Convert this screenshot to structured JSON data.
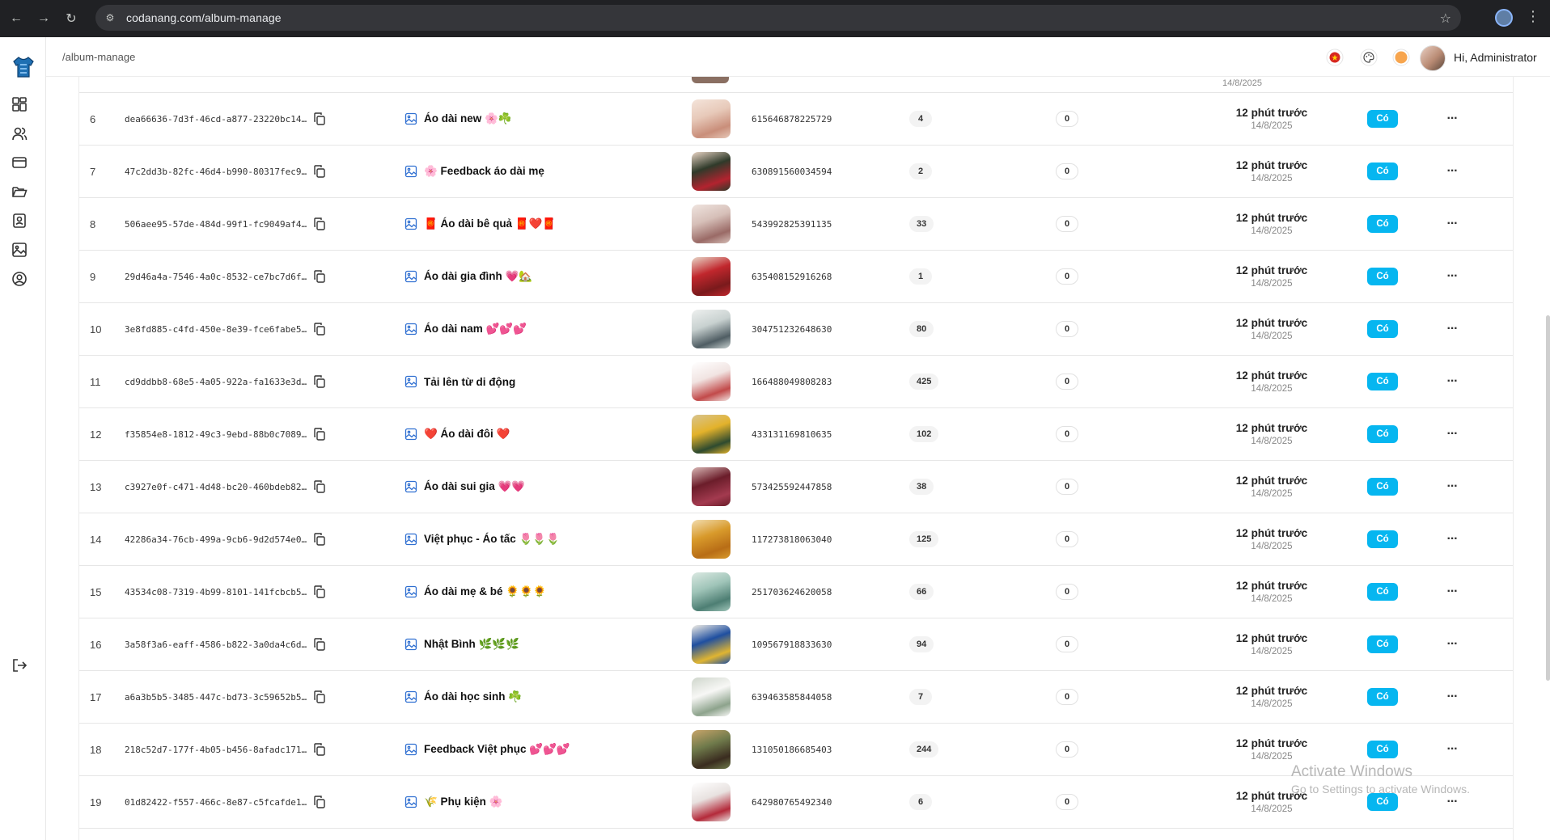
{
  "browser": {
    "url": "codanang.com/album-manage",
    "back_icon": "arrow-left-icon",
    "forward_icon": "arrow-right-icon",
    "reload_icon": "reload-icon"
  },
  "header": {
    "breadcrumb": "/album-manage",
    "greeting": "Hi, Administrator"
  },
  "sidebar": {
    "items": [
      {
        "icon": "dashboard-icon"
      },
      {
        "icon": "users-icon"
      },
      {
        "icon": "card-icon"
      },
      {
        "icon": "folder-icon"
      },
      {
        "icon": "contact-book-icon"
      },
      {
        "icon": "image-icon"
      },
      {
        "icon": "user-circle-icon"
      },
      {
        "icon": "logout-icon"
      }
    ]
  },
  "partial_top_date": "14/8/2025",
  "rows": [
    {
      "index": "6",
      "id": "dea66636-7d3f-46cd-a877-23220bc14…",
      "name": "Áo dài new 🌸☘️",
      "fb_id": "615646878225729",
      "count": "4",
      "zero": "0",
      "time": "12 phút trước",
      "date": "14/8/2025",
      "status": "Có",
      "thumb": [
        "#e7c9b9",
        "#c98e7a",
        "#f4e4da"
      ]
    },
    {
      "index": "7",
      "id": "47c2dd3b-82fc-46d4-b990-80317fec9…",
      "name": "🌸 Feedback áo dài mẹ",
      "fb_id": "630891560034594",
      "count": "2",
      "zero": "0",
      "time": "12 phút trước",
      "date": "14/8/2025",
      "status": "Có",
      "thumb": [
        "#2f3a2a",
        "#b3232f",
        "#e9d5c5"
      ]
    },
    {
      "index": "8",
      "id": "506aee95-57de-484d-99f1-fc9049af4…",
      "name": "🧧 Áo dài bê quả 🧧❤️🧧",
      "fb_id": "543992825391135",
      "count": "33",
      "zero": "0",
      "time": "12 phút trước",
      "date": "14/8/2025",
      "status": "Có",
      "thumb": [
        "#d6bfb8",
        "#9a6a66",
        "#efe4df"
      ]
    },
    {
      "index": "9",
      "id": "29d46a4a-7546-4a0c-8532-ce7bc7d6f…",
      "name": "Áo dài gia đình 💗🏡",
      "fb_id": "635408152916268",
      "count": "1",
      "zero": "0",
      "time": "12 phút trước",
      "date": "14/8/2025",
      "status": "Có",
      "thumb": [
        "#c1272d",
        "#7a1a1c",
        "#e8d7c8"
      ]
    },
    {
      "index": "10",
      "id": "3e8fd885-c4fd-450e-8e39-fce6fabe5…",
      "name": "Áo dài nam 💕💕💕",
      "fb_id": "304751232648630",
      "count": "80",
      "zero": "0",
      "time": "12 phút trước",
      "date": "14/8/2025",
      "status": "Có",
      "thumb": [
        "#c8d1d0",
        "#4f5d63",
        "#eef0ef"
      ]
    },
    {
      "index": "11",
      "id": "cd9ddbb8-68e5-4a05-922a-fa1633e3d…",
      "name": "Tải lên từ di động",
      "fb_id": "166488049808283",
      "count": "425",
      "zero": "0",
      "time": "12 phút trước",
      "date": "14/8/2025",
      "status": "Có",
      "thumb": [
        "#f1e4e2",
        "#c24a4a",
        "#ffffff"
      ]
    },
    {
      "index": "12",
      "id": "f35854e8-1812-49c3-9ebd-88b0c7089…",
      "name": "❤️ Áo dài đôi ❤️",
      "fb_id": "433131169810635",
      "count": "102",
      "zero": "0",
      "time": "12 phút trước",
      "date": "14/8/2025",
      "status": "Có",
      "thumb": [
        "#e3b22b",
        "#2e4a2f",
        "#d8c48f"
      ]
    },
    {
      "index": "13",
      "id": "c3927e0f-c471-4d48-bc20-460bdeb82…",
      "name": "Áo dài sui gia 💗💗",
      "fb_id": "573425592447858",
      "count": "38",
      "zero": "0",
      "time": "12 phút trước",
      "date": "14/8/2025",
      "status": "Có",
      "thumb": [
        "#6b1d2a",
        "#a33a4f",
        "#d9b7b5"
      ]
    },
    {
      "index": "14",
      "id": "42286a34-76cb-499a-9cb6-9d2d574e0…",
      "name": "Việt phục - Áo tấc 🌷🌷🌷",
      "fb_id": "117273818063040",
      "count": "125",
      "zero": "0",
      "time": "12 phút trước",
      "date": "14/8/2025",
      "status": "Có",
      "thumb": [
        "#d89a2b",
        "#b86d16",
        "#f2ddb0"
      ]
    },
    {
      "index": "15",
      "id": "43534c08-7319-4b99-8101-141fcbcb5…",
      "name": "Áo dài mẹ & bé 🌻🌻🌻",
      "fb_id": "251703624620058",
      "count": "66",
      "zero": "0",
      "time": "12 phút trước",
      "date": "14/8/2025",
      "status": "Có",
      "thumb": [
        "#9fc4b8",
        "#4d7e73",
        "#dbe9e2"
      ]
    },
    {
      "index": "16",
      "id": "3a58f3a6-eaff-4586-b822-3a0da4c6d…",
      "name": "Nhật Bình 🌿🌿🌿",
      "fb_id": "109567918833630",
      "count": "94",
      "zero": "0",
      "time": "12 phút trước",
      "date": "14/8/2025",
      "status": "Có",
      "thumb": [
        "#1f4fa0",
        "#e0b531",
        "#f3efe6"
      ]
    },
    {
      "index": "17",
      "id": "a6a3b5b5-3485-447c-bd73-3c59652b5…",
      "name": "Áo dài học sinh ☘️",
      "fb_id": "639463585844058",
      "count": "7",
      "zero": "0",
      "time": "12 phút trước",
      "date": "14/8/2025",
      "status": "Có",
      "thumb": [
        "#f7f7f5",
        "#8da38c",
        "#cfd6cc"
      ]
    },
    {
      "index": "18",
      "id": "218c52d7-177f-4b05-b456-8afadc171…",
      "name": "Feedback Việt phục 💕💕💕",
      "fb_id": "131050186685403",
      "count": "244",
      "zero": "0",
      "time": "12 phút trước",
      "date": "14/8/2025",
      "status": "Có",
      "thumb": [
        "#6f7a4b",
        "#3a2c1f",
        "#c9a56a"
      ]
    },
    {
      "index": "19",
      "id": "01d82422-f557-466c-8e87-c5fcafde1…",
      "name": "🌾 Phụ kiện 🌸",
      "fb_id": "642980765492340",
      "count": "6",
      "zero": "0",
      "time": "12 phút trước",
      "date": "14/8/2025",
      "status": "Có",
      "thumb": [
        "#e8e2e0",
        "#b42a3a",
        "#ffffff"
      ]
    }
  ],
  "watermark": {
    "line1": "Activate Windows",
    "line2": "Go to Settings to activate Windows."
  }
}
